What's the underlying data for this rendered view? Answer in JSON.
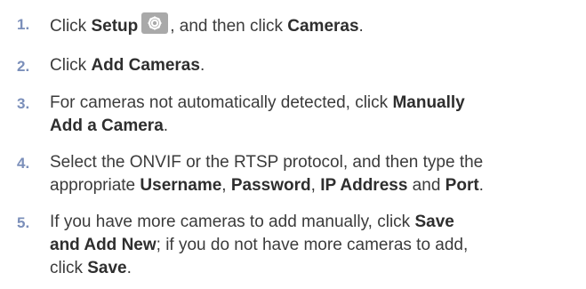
{
  "steps": [
    {
      "num": "1.",
      "parts": [
        "Click ",
        "Setup",
        ", and then click ",
        "Cameras",
        "."
      ],
      "icon": "gear-icon"
    },
    {
      "num": "2.",
      "parts": [
        "Click ",
        "Add Cameras",
        "."
      ]
    },
    {
      "num": "3.",
      "line1": [
        "For cameras not automatically detected, click ",
        "Manually"
      ],
      "line2": [
        "Add a Camera",
        "."
      ]
    },
    {
      "num": "4.",
      "line1": [
        "Select the ONVIF or the RTSP protocol, and then type the"
      ],
      "line2": [
        "appropriate ",
        "Username",
        ", ",
        "Password",
        ", ",
        "IP Address",
        " and ",
        "Port",
        "."
      ]
    },
    {
      "num": "5.",
      "line1": [
        "If you have more cameras to add manually, click ",
        "Save"
      ],
      "line2": [
        "and Add New",
        "; if you do not have more cameras to add,"
      ],
      "line3": [
        "click ",
        "Save",
        "."
      ]
    }
  ]
}
